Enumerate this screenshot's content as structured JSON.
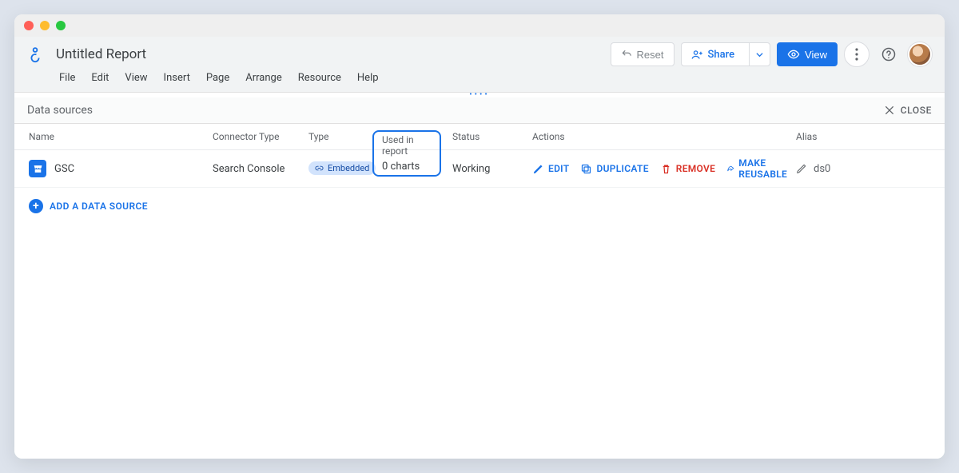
{
  "header": {
    "title": "Untitled Report",
    "reset_label": "Reset",
    "share_label": "Share",
    "view_label": "View"
  },
  "menu": {
    "items": [
      "File",
      "Edit",
      "View",
      "Insert",
      "Page",
      "Arrange",
      "Resource",
      "Help"
    ]
  },
  "panel": {
    "title": "Data sources",
    "close_label": "CLOSE",
    "columns": {
      "name": "Name",
      "connector": "Connector Type",
      "type": "Type",
      "used": "Used in report",
      "status": "Status",
      "actions": "Actions",
      "alias": "Alias"
    }
  },
  "row": {
    "name": "GSC",
    "connector": "Search Console",
    "type_chip": "Embedded",
    "used": "0 charts",
    "status": "Working",
    "alias": "ds0"
  },
  "actions": {
    "edit": "EDIT",
    "duplicate": "DUPLICATE",
    "remove": "REMOVE",
    "reusable": "MAKE REUSABLE"
  },
  "add_label": "ADD A DATA SOURCE"
}
